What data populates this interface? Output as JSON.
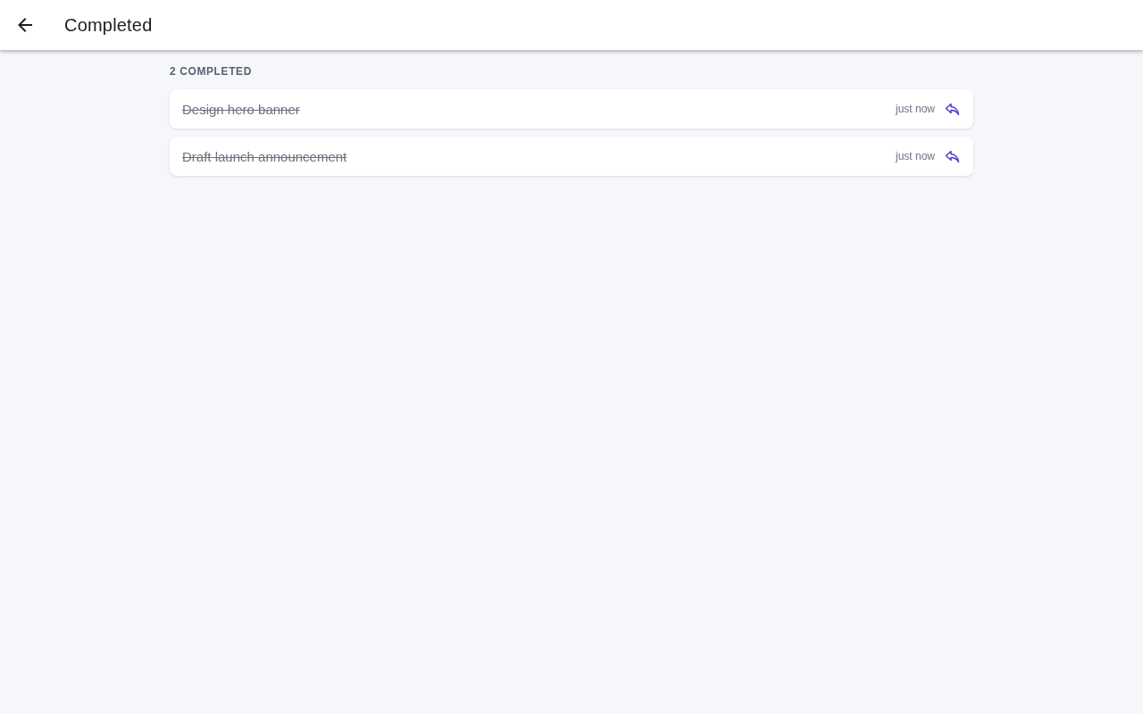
{
  "app_bar": {
    "title": "Completed"
  },
  "section": {
    "label": "2 COMPLETED"
  },
  "tasks": [
    {
      "title": "Design hero banner",
      "completed": true,
      "time": "just now"
    },
    {
      "title": "Draft launch announcement",
      "completed": true,
      "time": "just now"
    }
  ]
}
